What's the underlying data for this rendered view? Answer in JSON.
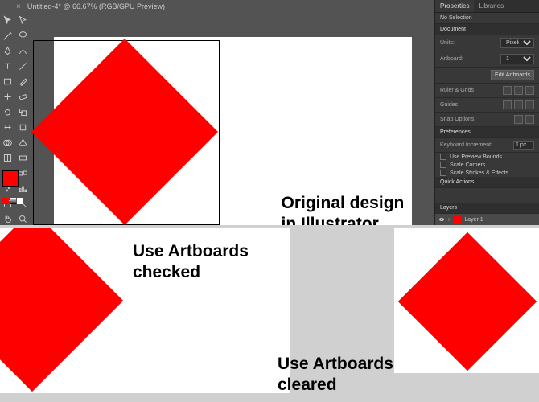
{
  "titlebar": {
    "close": "×",
    "label": "Untitled-4* @ 66.67% (RGB/GPU Preview)"
  },
  "captions": {
    "original_l1": "Original design",
    "original_l2": "in Illustrator",
    "checked_l1": "Use Artboards",
    "checked_l2": "checked",
    "cleared_l1": "Use Artboards",
    "cleared_l2": "cleared"
  },
  "panel": {
    "tab_properties": "Properties",
    "tab_libraries": "Libraries",
    "no_selection": "No Selection",
    "document": "Document",
    "units_label": "Units:",
    "units_value": "Pixels",
    "artboard_label": "Artboard:",
    "artboard_value": "1",
    "edit_artboards": "Edit Artboards",
    "ruler_grids": "Ruler & Grids",
    "guides": "Guides",
    "snap_options": "Snap Options",
    "preferences": "Preferences",
    "kb_increment": "Keyboard Increment:",
    "kb_value": "1 px",
    "use_preview_bounds": "Use Preview Bounds",
    "scale_corners": "Scale Corners",
    "scale_strokes": "Scale Strokes & Effects",
    "quick_actions": "Quick Actions",
    "layers": "Layers",
    "layer1": "Layer 1"
  }
}
